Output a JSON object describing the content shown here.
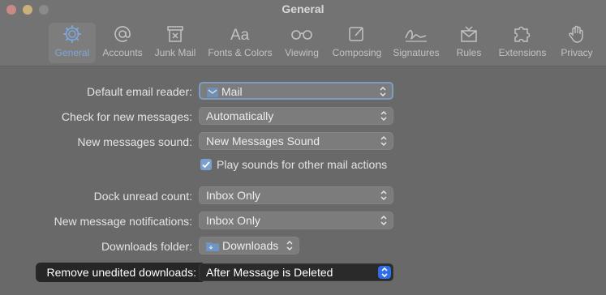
{
  "window": {
    "title": "General"
  },
  "toolbar": {
    "tabs": [
      {
        "label": "General",
        "icon": "gear-icon",
        "active": true
      },
      {
        "label": "Accounts",
        "icon": "at-icon"
      },
      {
        "label": "Junk Mail",
        "icon": "trash-icon"
      },
      {
        "label": "Fonts & Colors",
        "icon": "fonts-icon"
      },
      {
        "label": "Viewing",
        "icon": "glasses-icon"
      },
      {
        "label": "Composing",
        "icon": "compose-icon"
      },
      {
        "label": "Signatures",
        "icon": "signature-icon"
      },
      {
        "label": "Rules",
        "icon": "rules-icon"
      },
      {
        "label": "Extensions",
        "icon": "puzzle-icon"
      },
      {
        "label": "Privacy",
        "icon": "hand-icon"
      }
    ]
  },
  "settings": {
    "default_email_reader": {
      "label": "Default email reader:",
      "value": "Mail"
    },
    "check_messages": {
      "label": "Check for new messages:",
      "value": "Automatically"
    },
    "messages_sound": {
      "label": "New messages sound:",
      "value": "New Messages Sound"
    },
    "play_sounds": {
      "label": "Play sounds for other mail actions",
      "checked": true
    },
    "dock_unread": {
      "label": "Dock unread count:",
      "value": "Inbox Only"
    },
    "notifications": {
      "label": "New message notifications:",
      "value": "Inbox Only"
    },
    "downloads_folder": {
      "label": "Downloads folder:",
      "value": "Downloads"
    },
    "remove_downloads": {
      "label": "Remove unedited downloads:",
      "value": "After Message is Deleted"
    }
  },
  "colors": {
    "accent": "#2f6ee4",
    "highlight_bg": "#262626"
  }
}
